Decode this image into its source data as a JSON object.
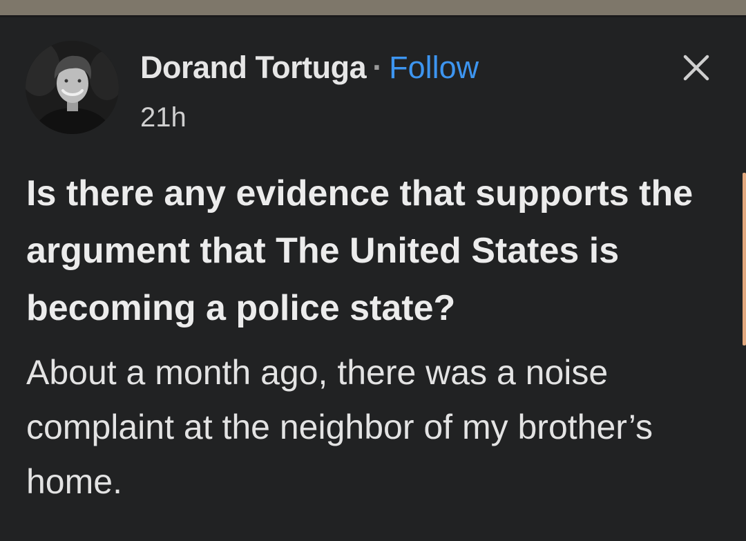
{
  "colors": {
    "background": "#212223",
    "follow_link": "#3d95f0",
    "top_bar": "#7e776a",
    "scroll_indicator": "#e2a87e"
  },
  "post": {
    "author": {
      "name": "Dorand Tortuga",
      "separator": "·",
      "follow_label": "Follow",
      "timestamp": "21h",
      "avatar_icon": "user-avatar-photo"
    },
    "close_icon": "close-icon",
    "question": "Is there any evidence that supports the argument that The United States is becoming a police state?",
    "answer_excerpt": "About a month ago, there was a noise complaint at the neighbor of my brother’s home."
  }
}
